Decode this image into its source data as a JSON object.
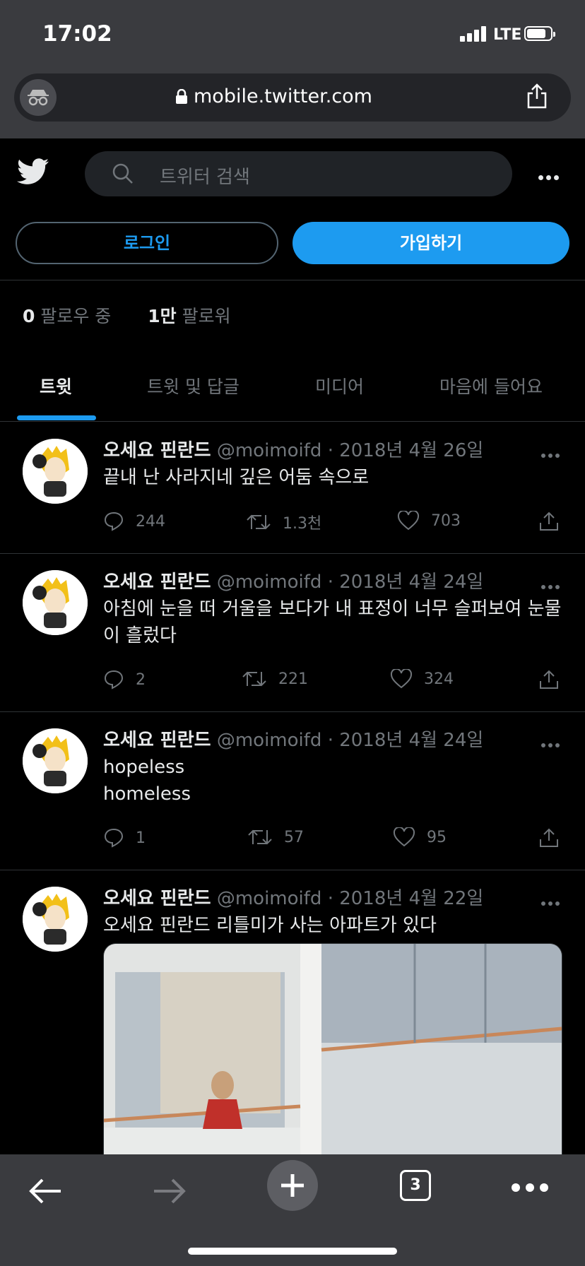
{
  "status": {
    "time": "17:02",
    "network": "LTE"
  },
  "browser": {
    "url": "mobile.twitter.com",
    "tabs_count": "3"
  },
  "twitter": {
    "search_placeholder": "트위터 검색",
    "login_label": "로그인",
    "signup_label": "가입하기"
  },
  "profile": {
    "following_count": "0",
    "following_label": "팔로우 중",
    "followers_count": "1만",
    "followers_label": "팔로워"
  },
  "tabs": [
    {
      "label": "트윗",
      "active": true
    },
    {
      "label": "트윗 및 답글",
      "active": false
    },
    {
      "label": "미디어",
      "active": false
    },
    {
      "label": "마음에 들어요",
      "active": false
    }
  ],
  "tweets": [
    {
      "name": "오세요 핀란드",
      "handle": "@moimoifd",
      "date": "· 2018년 4월 26일",
      "text": "끝내 난 사라지네 깊은 어둠 속으로",
      "replies": "244",
      "retweets": "1.3천",
      "likes": "703"
    },
    {
      "name": "오세요 핀란드",
      "handle": "@moimoifd",
      "date": "· 2018년 4월 24일",
      "text": "아침에 눈을 떠 거울을 보다가 내 표정이 너무 슬퍼보여 눈물이 흘렀다",
      "replies": "2",
      "retweets": "221",
      "likes": "324"
    },
    {
      "name": "오세요 핀란드",
      "handle": "@moimoifd",
      "date": "· 2018년 4월 24일",
      "text_line1": "hopeless",
      "text_line2": "homeless",
      "replies": "1",
      "retweets": "57",
      "likes": "95"
    },
    {
      "name": "오세요 핀란드",
      "handle": "@moimoifd",
      "date": "· 2018년 4월 22일",
      "text": "오세요 핀란드 리틀미가 사는 아파트가 있다"
    }
  ],
  "colors": {
    "accent": "#1d9bf0",
    "background": "#000000",
    "chrome": "#3a3b3f"
  }
}
